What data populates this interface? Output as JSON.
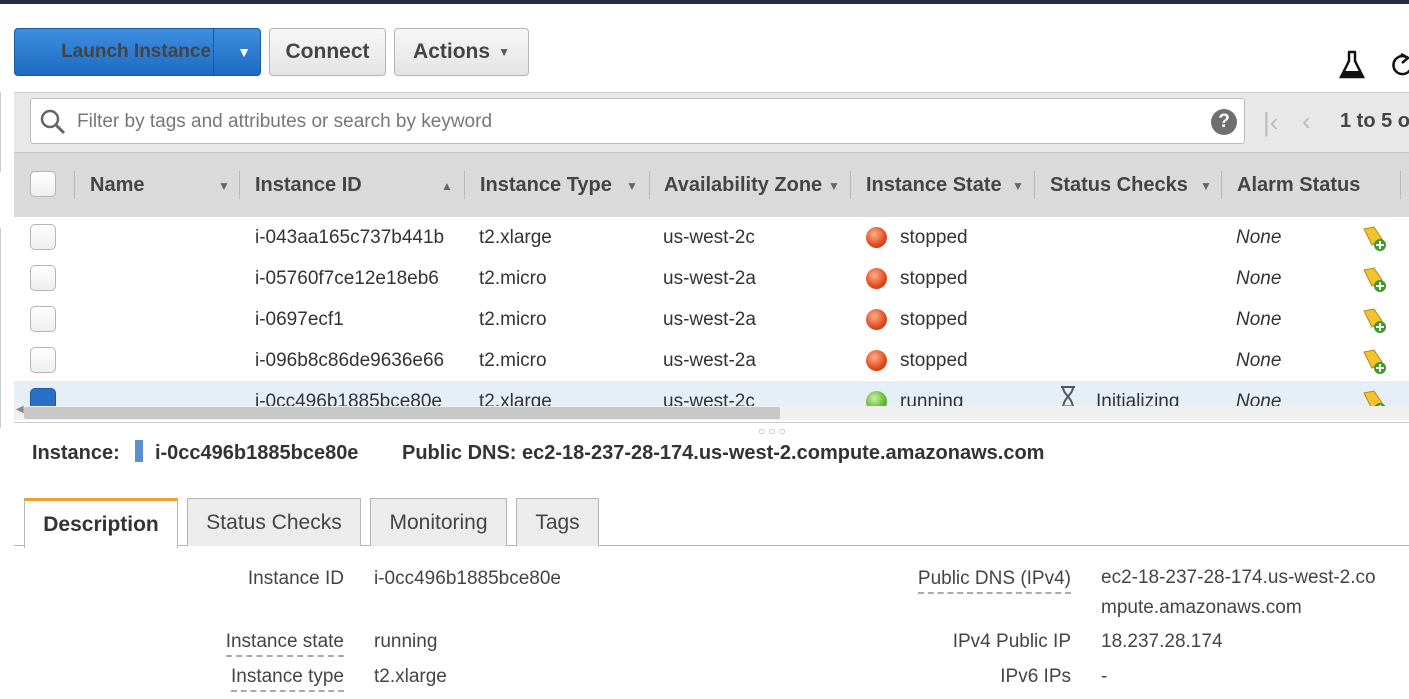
{
  "toolbar": {
    "launch_label": "Launch Instance",
    "connect_label": "Connect",
    "actions_label": "Actions"
  },
  "search": {
    "placeholder": "Filter by tags and attributes or search by keyword",
    "help": "?"
  },
  "pager": {
    "text": "1 to 5 o"
  },
  "table": {
    "columns": [
      "Name",
      "Instance ID",
      "Instance Type",
      "Availability Zone",
      "Instance State",
      "Status Checks",
      "Alarm Status"
    ],
    "rows": [
      {
        "name": "",
        "instance_id": "i-043aa165c737b441b",
        "type": "t2.xlarge",
        "zone": "us-west-2c",
        "state": "stopped",
        "status_checks": "",
        "alarm": "None"
      },
      {
        "name": "",
        "instance_id": "i-05760f7ce12e18eb6",
        "type": "t2.micro",
        "zone": "us-west-2a",
        "state": "stopped",
        "status_checks": "",
        "alarm": "None"
      },
      {
        "name": "",
        "instance_id": "i-0697ecf1",
        "type": "t2.micro",
        "zone": "us-west-2a",
        "state": "stopped",
        "status_checks": "",
        "alarm": "None"
      },
      {
        "name": "",
        "instance_id": "i-096b8c86de9636e66",
        "type": "t2.micro",
        "zone": "us-west-2a",
        "state": "stopped",
        "status_checks": "",
        "alarm": "None"
      },
      {
        "name": "",
        "instance_id": "i-0cc496b1885bce80e",
        "type": "t2.xlarge",
        "zone": "us-west-2c",
        "state": "running",
        "status_checks": "Initializing",
        "alarm": "None"
      }
    ]
  },
  "detail": {
    "instance_label": "Instance:",
    "instance_id": "i-0cc496b1885bce80e",
    "dns_label": "Public DNS:",
    "dns_value": "ec2-18-237-28-174.us-west-2.compute.amazonaws.com",
    "tabs": [
      "Description",
      "Status Checks",
      "Monitoring",
      "Tags"
    ],
    "fields": {
      "instance_id_label": "Instance ID",
      "instance_id_value": "i-0cc496b1885bce80e",
      "instance_state_label": "Instance state",
      "instance_state_value": "running",
      "instance_type_label": "Instance type",
      "instance_type_value": "t2.xlarge",
      "public_dns_label": "Public DNS (IPv4)",
      "public_dns_value": "ec2-18-237-28-174.us-west-2.compute.amazonaws.com",
      "ipv4_label": "IPv4 Public IP",
      "ipv4_value": "18.237.28.174",
      "ipv6_label": "IPv6 IPs",
      "ipv6_value": "-"
    }
  }
}
